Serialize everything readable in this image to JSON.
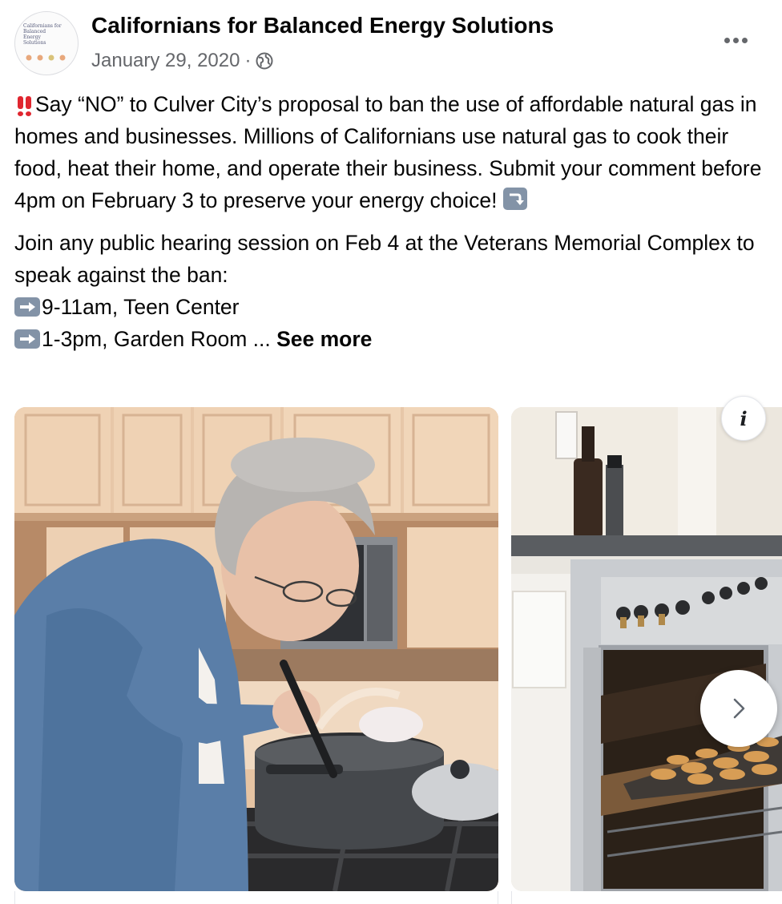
{
  "post": {
    "author": "Californians for Balanced Energy Solutions",
    "avatar_text": "Californians for\nBalanced\nEnergy\nSolutions",
    "date": "January 29, 2020",
    "separator": "·",
    "privacy_icon": "globe-icon",
    "more_icon": "more-options-icon",
    "paragraph1": {
      "lead_icon": "double-exclamation-icon",
      "text": "Say “NO” to Culver City’s proposal to ban the use of affordable natural gas in homes and businesses. Millions of Californians use natural gas to cook their food, heat their home, and operate their business. Submit your comment before 4pm on February 3 to preserve your energy choice!",
      "trail_icon": "arrow-turn-down-icon"
    },
    "paragraph2": {
      "intro": "Join any public hearing session on Feb 4 at the Veterans Memorial Complex to speak against the ban:",
      "item1_icon": "right-arrow-icon",
      "item1": "9-11am, Teen Center",
      "item2_icon": "right-arrow-icon",
      "item2": "1-3pm, Garden Room ...",
      "see_more": "See more"
    }
  },
  "carousel": {
    "cards": [
      {
        "image": "woman-cooking-at-gas-stove"
      },
      {
        "image": "cookies-baking-in-gas-oven"
      }
    ],
    "info_button": "i",
    "next_icon": "chevron-right-icon"
  },
  "colors": {
    "text": "#050505",
    "secondary_text": "#65676b",
    "emoji_red": "#e0262f",
    "emoji_box": "#8393a7"
  }
}
